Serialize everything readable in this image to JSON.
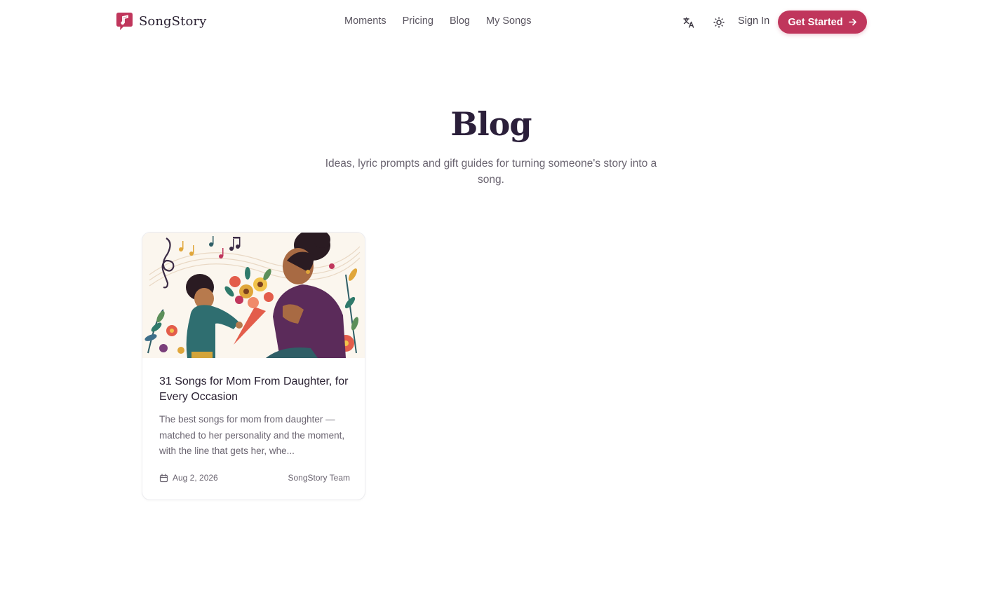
{
  "brand": {
    "name": "SongStory",
    "accent": "#c0365c"
  },
  "nav": {
    "items": [
      {
        "label": "Moments"
      },
      {
        "label": "Pricing"
      },
      {
        "label": "Blog"
      },
      {
        "label": "My Songs"
      }
    ],
    "translate_icon": "translate-icon",
    "theme_icon": "sun-icon",
    "sign_in": "Sign In",
    "cta": "Get Started"
  },
  "hero": {
    "title": "Blog",
    "subtitle": "Ideas, lyric prompts and gift guides for turning someone's story into a song."
  },
  "posts": [
    {
      "title": "31 Songs for Mom From Daughter, for Every Occasion",
      "excerpt": "The best songs for mom from daughter — matched to her personality and the moment, with the line that gets her, whe...",
      "date": "Aug 2, 2026",
      "author": "SongStory Team"
    }
  ]
}
